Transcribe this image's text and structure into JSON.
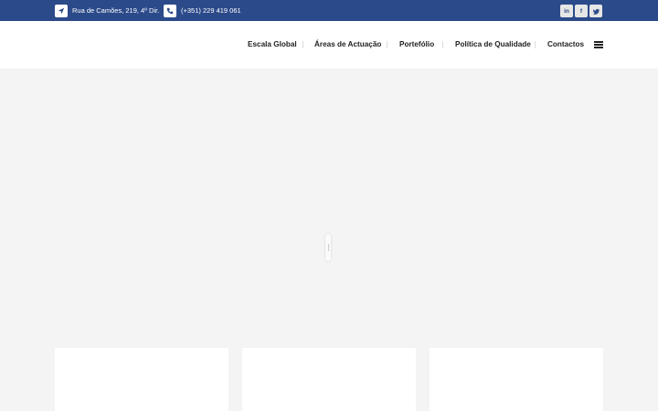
{
  "topbar": {
    "address": "Rua de Camões, 219, 4º Dir.",
    "address_icon": "location-arrow-icon",
    "phone": "(+351) 229 419 061",
    "phone_icon": "phone-icon",
    "social": [
      {
        "name": "linkedin-icon",
        "glyph": "in"
      },
      {
        "name": "facebook-icon",
        "glyph": "f"
      },
      {
        "name": "twitter-icon",
        "glyph": "t"
      }
    ],
    "background": "#2b4a8a"
  },
  "nav": {
    "items": [
      "Escala Global",
      "Áreas de Actuação",
      "Portefólio",
      "Política de Qualidade",
      "Contactos"
    ],
    "menu_icon": "hamburger-menu-icon"
  }
}
